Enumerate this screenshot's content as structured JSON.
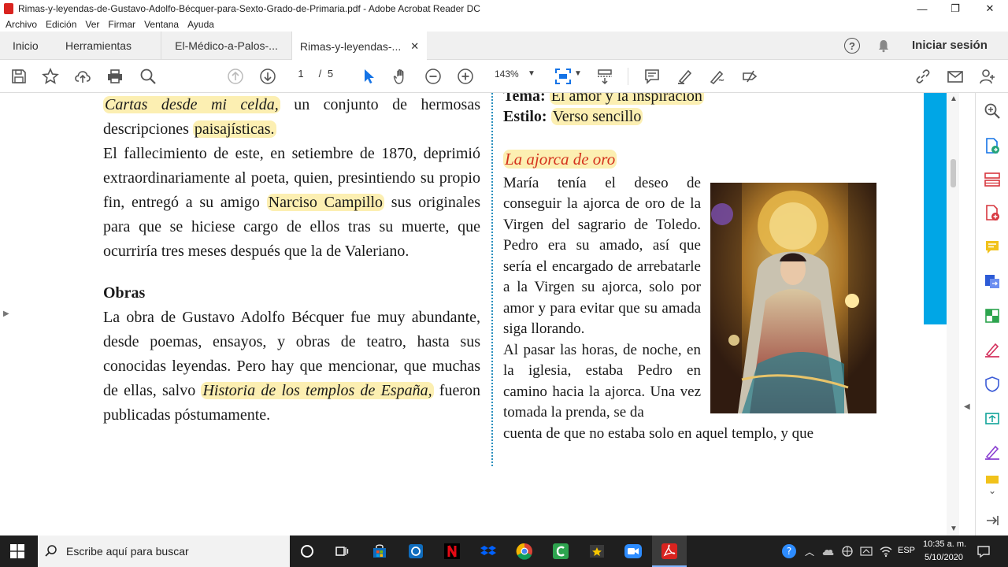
{
  "window": {
    "title": "Rimas-y-leyendas-de-Gustavo-Adolfo-Bécquer-para-Sexto-Grado-de-Primaria.pdf - Adobe Acrobat Reader DC",
    "controls": {
      "minimize": "—",
      "restore": "❐",
      "close": "✕"
    }
  },
  "menu": [
    "Archivo",
    "Edición",
    "Ver",
    "Firmar",
    "Ventana",
    "Ayuda"
  ],
  "tabs": {
    "home": "Inicio",
    "tools": "Herramientas",
    "doc1": "El-Médico-a-Palos-...",
    "doc2": "Rimas-y-leyendas-...",
    "close": "✕",
    "signin": "Iniciar sesión",
    "help": "?"
  },
  "toolbar": {
    "page_current": "1",
    "page_sep": "/",
    "page_total": "5",
    "zoom": "143%"
  },
  "document": {
    "left": {
      "p1_a": "Cartas desde mi celda,",
      "p1_b": " un conjunto de hermosas descripciones ",
      "p1_c": "paisajísticas.",
      "p2_a": "El fallecimiento de este, en setiembre de 1870, deprimió extraordinariamente al poeta, quien, presintiendo su propio fin, entregó a su amigo ",
      "p2_b": "Narciso Campillo",
      "p2_c": " sus originales para que se hiciese cargo de ellos tras su muerte, que ocurriría tres meses después que la de Valeriano.",
      "heading": "Obras",
      "p3_a": "La obra de Gustavo Adolfo Bécquer fue muy abundante, desde poemas, ensayos, y obras de teatro, hasta sus conocidas leyendas. Pero hay que mencionar, que muchas de ellas, salvo ",
      "p3_b": "Historia de los templos de España,",
      "p3_c": " fueron publicadas póstumamente."
    },
    "right": {
      "tema_label": "Tema:",
      "tema_value": "El amor y la inspiración",
      "estilo_label": "Estilo:",
      "estilo_value": "Verso sencillo",
      "subtitle": "La ajorca de oro",
      "para1": "María tenía el deseo de conseguir la ajorca de oro de la Virgen del sagrario de Toledo. Pedro era su amado, así que sería el encargado de arrebatarle a la Virgen su ajorca, solo por amor y para evitar que su amada siga llorando.",
      "para2": "Al pasar las horas, de noche, en la iglesia, estaba Pedro en camino hacia la ajorca. Una vez tomada la prenda, se da",
      "para2_cont": "cuenta de que no estaba solo en aquel templo, y que"
    }
  },
  "taskbar": {
    "search_placeholder": "Escribe aquí para buscar",
    "lang": "ESP",
    "time": "10:35 a. m.",
    "date": "5/10/2020"
  },
  "colors": {
    "highlight": "#fcefb2",
    "subtitle": "#d4321d",
    "divider": "#2a8fbd",
    "accent_blue": "#00a6e6",
    "acrobat_red": "#d9231f"
  }
}
